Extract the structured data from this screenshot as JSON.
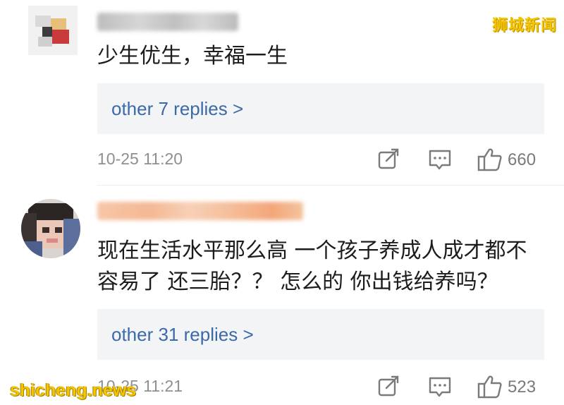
{
  "watermarks": {
    "top_right": "狮城新闻",
    "bottom_left": "shicheng.news"
  },
  "comments": [
    {
      "text": "少生优生，幸福一生",
      "replies_label": "other 7 replies >",
      "timestamp": "10-25 11:20",
      "likes": "660"
    },
    {
      "text": "现在生活水平那么高 一个孩子养成人成才都不容易了 还三胎？？ 怎么的 你出钱给养吗？",
      "replies_label": "other 31 replies >",
      "timestamp": "10-25 11:21",
      "likes": "523"
    }
  ],
  "icons": {
    "share": "share-edit-icon",
    "reply": "comment-icon",
    "like": "thumbs-up-icon"
  },
  "colors": {
    "reply_link": "#3b6aa8",
    "reply_bg": "#f3f4f6",
    "meta_gray": "#8f8f8f",
    "watermark": "#f5c400"
  }
}
